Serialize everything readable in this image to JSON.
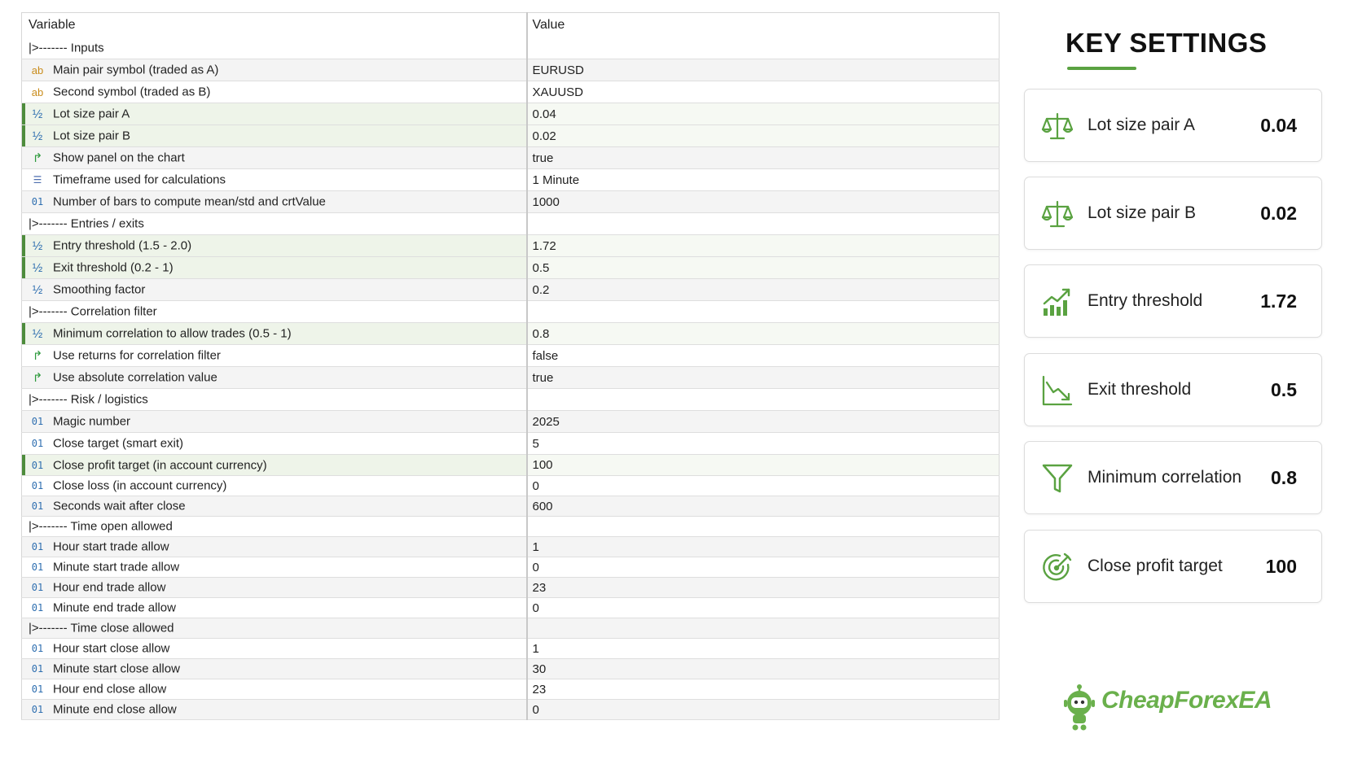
{
  "table": {
    "header": {
      "variable": "Variable",
      "value": "Value"
    },
    "rows": [
      {
        "type": "group",
        "label": "|>------- Inputs",
        "value": "",
        "hl": false
      },
      {
        "type": "string",
        "icon": "ab",
        "label": "Main pair symbol (traded as A)",
        "value": "EURUSD",
        "hl": false
      },
      {
        "type": "string",
        "icon": "ab",
        "label": "Second symbol (traded as B)",
        "value": "XAUUSD",
        "hl": false
      },
      {
        "type": "double",
        "icon": "½",
        "label": "Lot size pair A",
        "value": "0.04",
        "hl": true
      },
      {
        "type": "double",
        "icon": "½",
        "label": "Lot size pair B",
        "value": "0.02",
        "hl": true
      },
      {
        "type": "bool",
        "icon": "↱",
        "label": "Show panel on the chart",
        "value": "true",
        "hl": false
      },
      {
        "type": "enum",
        "icon": "☰",
        "label": "Timeframe used for calculations",
        "value": "1 Minute",
        "hl": false
      },
      {
        "type": "int",
        "icon": "01",
        "label": "Number of bars to compute mean/std and crtValue",
        "value": "1000",
        "hl": false
      },
      {
        "type": "group",
        "label": "|>------- Entries / exits",
        "value": "",
        "hl": false
      },
      {
        "type": "double",
        "icon": "½",
        "label": "Entry threshold (1.5 - 2.0)",
        "value": "1.72",
        "hl": true
      },
      {
        "type": "double",
        "icon": "½",
        "label": "Exit threshold (0.2 - 1)",
        "value": "0.5",
        "hl": true
      },
      {
        "type": "double",
        "icon": "½",
        "label": "Smoothing factor",
        "value": "0.2",
        "hl": false
      },
      {
        "type": "group",
        "label": "|>------- Correlation filter",
        "value": "",
        "hl": false
      },
      {
        "type": "double",
        "icon": "½",
        "label": "Minimum correlation to allow trades (0.5 - 1)",
        "value": "0.8",
        "hl": true
      },
      {
        "type": "bool",
        "icon": "↱",
        "label": "Use returns for correlation filter",
        "value": "false",
        "hl": false
      },
      {
        "type": "bool",
        "icon": "↱",
        "label": "Use absolute correlation value",
        "value": "true",
        "hl": false
      },
      {
        "type": "group",
        "label": "|>------- Risk / logistics",
        "value": "",
        "hl": false
      },
      {
        "type": "int",
        "icon": "01",
        "label": "Magic number",
        "value": "2025",
        "hl": false
      },
      {
        "type": "int",
        "icon": "01",
        "label": "Close target (smart exit)",
        "value": "5",
        "hl": false
      },
      {
        "type": "int",
        "icon": "01",
        "label": "Close profit target (in account currency)",
        "value": "100",
        "hl": true
      },
      {
        "type": "int",
        "icon": "01",
        "label": "Close loss (in account currency)",
        "value": "0",
        "hl": false
      },
      {
        "type": "int",
        "icon": "01",
        "label": "Seconds wait after close",
        "value": "600",
        "hl": false
      },
      {
        "type": "group",
        "label": "|>------- Time open allowed",
        "value": "",
        "hl": false
      },
      {
        "type": "int",
        "icon": "01",
        "label": "Hour start trade allow",
        "value": "1",
        "hl": false
      },
      {
        "type": "int",
        "icon": "01",
        "label": "Minute start trade allow",
        "value": "0",
        "hl": false
      },
      {
        "type": "int",
        "icon": "01",
        "label": "Hour end trade allow",
        "value": "23",
        "hl": false
      },
      {
        "type": "int",
        "icon": "01",
        "label": "Minute end trade allow",
        "value": "0",
        "hl": false
      },
      {
        "type": "group",
        "label": "|>------- Time close allowed",
        "value": "",
        "hl": false
      },
      {
        "type": "int",
        "icon": "01",
        "label": "Hour start close allow",
        "value": "1",
        "hl": false
      },
      {
        "type": "int",
        "icon": "01",
        "label": "Minute start close allow",
        "value": "30",
        "hl": false
      },
      {
        "type": "int",
        "icon": "01",
        "label": "Hour end close allow",
        "value": "23",
        "hl": false
      },
      {
        "type": "int",
        "icon": "01",
        "label": "Minute end close allow",
        "value": "0",
        "hl": false
      }
    ]
  },
  "key_settings": {
    "title": "KEY SETTINGS",
    "accent_color": "#5aa241",
    "cards": [
      {
        "icon": "balance-scale-icon",
        "label": "Lot size pair A",
        "value": "0.04"
      },
      {
        "icon": "balance-scale-icon",
        "label": "Lot size pair B",
        "value": "0.02"
      },
      {
        "icon": "chart-up-icon",
        "label": "Entry threshold",
        "value": "1.72"
      },
      {
        "icon": "chart-down-icon",
        "label": "Exit threshold",
        "value": "0.5"
      },
      {
        "icon": "funnel-icon",
        "label": "Minimum correlation",
        "value": "0.8"
      },
      {
        "icon": "target-icon",
        "label": "Close profit target",
        "value": "100"
      }
    ]
  },
  "logo": {
    "text": "CheapForexEA",
    "color": "#6ab04c"
  }
}
